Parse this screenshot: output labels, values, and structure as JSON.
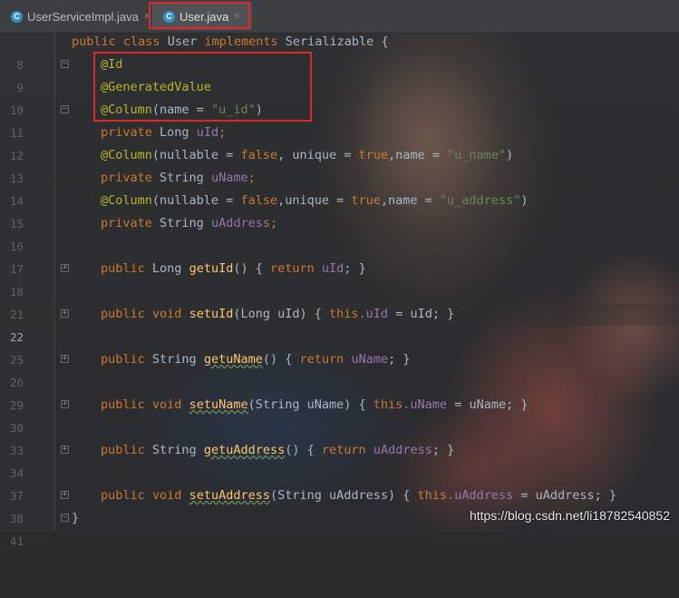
{
  "tabs": [
    {
      "label": "UserServiceImpl.java",
      "icon": "C",
      "close": "×"
    },
    {
      "label": "User.java",
      "icon": "C",
      "close": "×"
    }
  ],
  "lines": [
    {
      "num": "8"
    },
    {
      "num": "9"
    },
    {
      "num": "10"
    },
    {
      "num": "11"
    },
    {
      "num": "12"
    },
    {
      "num": "13"
    },
    {
      "num": "14"
    },
    {
      "num": "15"
    },
    {
      "num": "16"
    },
    {
      "num": "17"
    },
    {
      "num": "18"
    },
    {
      "num": "21"
    },
    {
      "num": "22"
    },
    {
      "num": "25"
    },
    {
      "num": "26"
    },
    {
      "num": "29"
    },
    {
      "num": "30"
    },
    {
      "num": "33"
    },
    {
      "num": "34"
    },
    {
      "num": "37"
    },
    {
      "num": "38"
    },
    {
      "num": "41"
    }
  ],
  "code": {
    "l8": {
      "kw1": "public",
      "kw2": "class",
      "name": "User",
      "kw3": "implements",
      "iface": "Serializable",
      "brace": "{"
    },
    "l9": {
      "ann": "@Id"
    },
    "l10": {
      "ann": "@GeneratedValue"
    },
    "l11": {
      "ann": "@Column",
      "p1": "(name = ",
      "s": "\"u_id\"",
      "p2": ")"
    },
    "l12": {
      "kw": "private",
      "type": "Long",
      "fld": "uId",
      "semi": ";"
    },
    "l13": {
      "ann": "@Column",
      "p1": "(nullable = ",
      "k1": "false",
      "p2": ", unique = ",
      "k2": "true",
      "p3": ",name = ",
      "s": "\"u_name\"",
      "p4": ")"
    },
    "l14": {
      "kw": "private",
      "type": "String",
      "fld": "uName",
      "semi": ";"
    },
    "l15": {
      "ann": "@Column",
      "p1": "(nullable = ",
      "k1": "false",
      "p2": ",unique = ",
      "k2": "true",
      "p3": ",name = ",
      "s": "\"u_address\"",
      "p4": ")"
    },
    "l16": {
      "kw": "private",
      "type": "String",
      "fld": "uAddress",
      "semi": ";"
    },
    "l18": {
      "kw": "public",
      "type": "Long",
      "mth": "getuId",
      "p1": "() { ",
      "ret": "return",
      "fld": "uId",
      "p2": "; }"
    },
    "l22": {
      "kw1": "public",
      "kw2": "void",
      "mth": "setuId",
      "p1": "(Long uId) { ",
      "th": "this",
      "fld": ".uId",
      "p2": " = uId; }"
    },
    "l26": {
      "kw": "public",
      "type": "String",
      "mth": "getuName",
      "p1": "() { ",
      "ret": "return",
      "fld": "uName",
      "p2": "; }"
    },
    "l30": {
      "kw1": "public",
      "kw2": "void",
      "mth": "setuName",
      "p1": "(String uName) { ",
      "th": "this",
      "fld": ".uName",
      "p2": " = uName; }"
    },
    "l34": {
      "kw": "public",
      "type": "String",
      "mth": "getuAddress",
      "p1": "() { ",
      "ret": "return",
      "fld": "uAddress",
      "p2": "; }"
    },
    "l38": {
      "kw1": "public",
      "kw2": "void",
      "mth": "setuAddress",
      "p1": "(String uAddress) { ",
      "th": "this",
      "fld": ".uAddress",
      "p2": " = uAddress; }"
    },
    "l41": {
      "brace": "}"
    }
  },
  "watermark": "https://blog.csdn.net/li18782540852",
  "colors": {
    "keyword": "#cc7832",
    "annotation": "#bbb529",
    "string": "#6a8759",
    "field": "#9876aa",
    "method": "#ffc66d",
    "highlight_box": "#e0262b"
  }
}
